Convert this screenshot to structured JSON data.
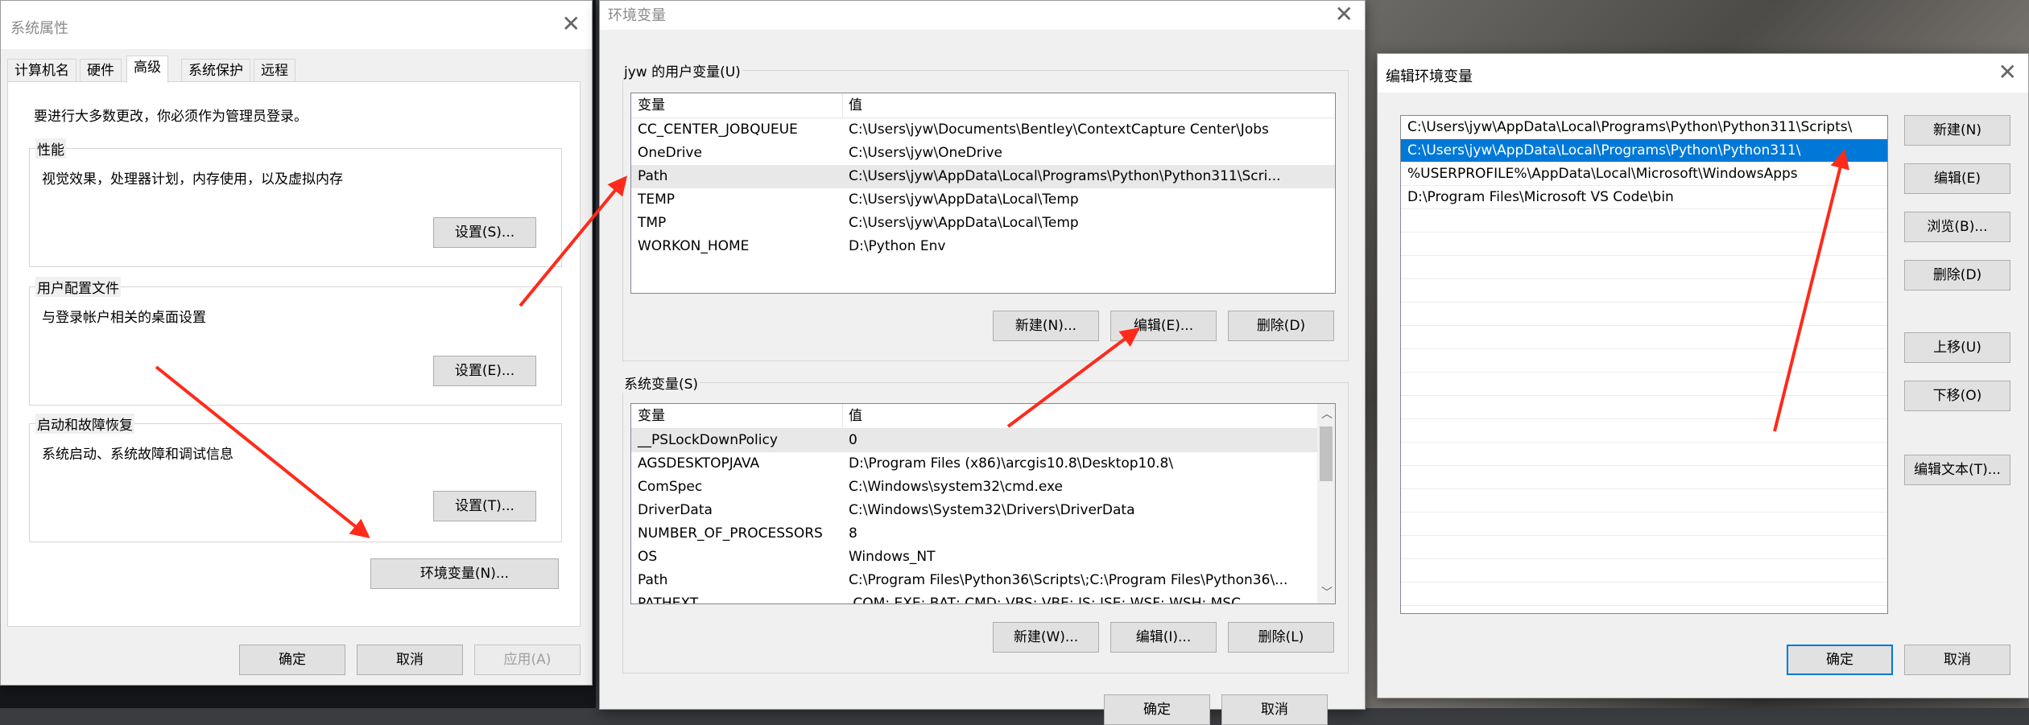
{
  "sysprops": {
    "title": "系统属性",
    "tabs": [
      "计算机名",
      "硬件",
      "高级",
      "系统保护",
      "远程"
    ],
    "admin_note": "要进行大多数更改，你必须作为管理员登录。",
    "perf": {
      "label": "性能",
      "desc": "视觉效果，处理器计划，内存使用，以及虚拟内存",
      "button": "设置(S)..."
    },
    "profile": {
      "label": "用户配置文件",
      "desc": "与登录帐户相关的桌面设置",
      "button": "设置(E)..."
    },
    "startup": {
      "label": "启动和故障恢复",
      "desc": "系统启动、系统故障和调试信息",
      "button": "设置(T)..."
    },
    "env_button": "环境变量(N)...",
    "ok": "确定",
    "cancel": "取消",
    "apply": "应用(A)"
  },
  "envvars": {
    "title": "环境变量",
    "user_group": "jyw 的用户变量(U)",
    "col_var": "变量",
    "col_val": "值",
    "user_vars": [
      {
        "name": "CC_CENTER_JOBQUEUE",
        "value": "C:\\Users\\jyw\\Documents\\Bentley\\ContextCapture Center\\Jobs"
      },
      {
        "name": "OneDrive",
        "value": "C:\\Users\\jyw\\OneDrive"
      },
      {
        "name": "Path",
        "value": "C:\\Users\\jyw\\AppData\\Local\\Programs\\Python\\Python311\\Scri..."
      },
      {
        "name": "TEMP",
        "value": "C:\\Users\\jyw\\AppData\\Local\\Temp"
      },
      {
        "name": "TMP",
        "value": "C:\\Users\\jyw\\AppData\\Local\\Temp"
      },
      {
        "name": "WORKON_HOME",
        "value": "D:\\Python Env"
      }
    ],
    "user_new": "新建(N)...",
    "user_edit": "编辑(E)...",
    "user_delete": "删除(D)",
    "sys_group": "系统变量(S)",
    "sys_vars": [
      {
        "name": "__PSLockDownPolicy",
        "value": "0"
      },
      {
        "name": "AGSDESKTOPJAVA",
        "value": "D:\\Program Files (x86)\\arcgis10.8\\Desktop10.8\\"
      },
      {
        "name": "ComSpec",
        "value": "C:\\Windows\\system32\\cmd.exe"
      },
      {
        "name": "DriverData",
        "value": "C:\\Windows\\System32\\Drivers\\DriverData"
      },
      {
        "name": "NUMBER_OF_PROCESSORS",
        "value": "8"
      },
      {
        "name": "OS",
        "value": "Windows_NT"
      },
      {
        "name": "Path",
        "value": "C:\\Program Files\\Python36\\Scripts\\;C:\\Program Files\\Python36\\..."
      },
      {
        "name": "PATHEXT",
        "value": ".COM;.EXE;.BAT;.CMD;.VBS;.VBE;.JS;.JSE;.WSF;.WSH;.MSC"
      }
    ],
    "sys_new": "新建(W)...",
    "sys_edit": "编辑(I)...",
    "sys_delete": "删除(L)",
    "ok": "确定",
    "cancel": "取消"
  },
  "editenv": {
    "title": "编辑环境变量",
    "entries": [
      "C:\\Users\\jyw\\AppData\\Local\\Programs\\Python\\Python311\\Scripts\\",
      "C:\\Users\\jyw\\AppData\\Local\\Programs\\Python\\Python311\\",
      "%USERPROFILE%\\AppData\\Local\\Microsoft\\WindowsApps",
      "D:\\Program Files\\Microsoft VS Code\\bin"
    ],
    "selected_index": 1,
    "new": "新建(N)",
    "edit": "编辑(E)",
    "browse": "浏览(B)...",
    "delete": "删除(D)",
    "up": "上移(U)",
    "down": "下移(O)",
    "edit_text": "编辑文本(T)...",
    "ok": "确定",
    "cancel": "取消"
  },
  "accent_color": "#0078d7",
  "arrow_color": "#ff2a1a"
}
